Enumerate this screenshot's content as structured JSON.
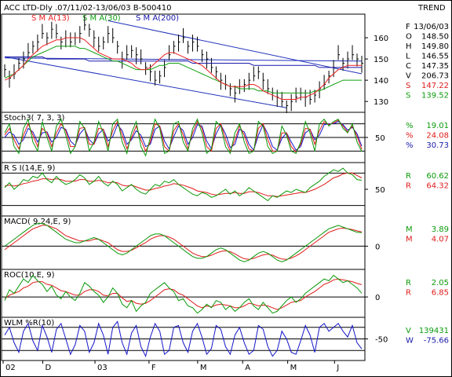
{
  "header": {
    "title": "ACC LTD-Dly .07/11/02-13/06/03   B-500410",
    "right": "TREND"
  },
  "colors": {
    "price": "#000000",
    "sma13": "#ee2222",
    "sma30": "#11a011",
    "sma200": "#1a1aaa",
    "channel": "#2233bb",
    "blueLine": "#1515c8",
    "red": "#e01b1b",
    "green": "#0a9a0a"
  },
  "chart_data": [
    {
      "id": "price",
      "type": "line",
      "legend": [
        {
          "name": "S M A(13)",
          "color": "#ee2222"
        },
        {
          "name": "S M A(30)",
          "color": "#11a011"
        },
        {
          "name": "S M A(200)",
          "color": "#1a1aaa"
        }
      ],
      "yticks": [
        130,
        140,
        150,
        160
      ],
      "ylim": [
        126,
        170
      ],
      "info": [
        {
          "label": "F",
          "value": "13/06/03"
        },
        {
          "label": "O",
          "value": "148.50"
        },
        {
          "label": "H",
          "value": "149.80"
        },
        {
          "label": "L",
          "value": "146.55"
        },
        {
          "label": "C",
          "value": "147.35"
        },
        {
          "label": "V",
          "value": "206.73"
        },
        {
          "label": "S",
          "value": "147.22",
          "color": "#e01b1b"
        },
        {
          "label": "S",
          "value": "139.52",
          "color": "#0a9a0a"
        }
      ],
      "close_series": [
        145,
        141,
        143,
        148,
        150,
        153,
        156,
        158,
        162,
        160,
        164,
        162,
        158,
        160,
        158,
        160,
        162,
        166,
        164,
        160,
        156,
        158,
        162,
        160,
        156,
        150,
        152,
        154,
        152,
        150,
        146,
        144,
        140,
        142,
        146,
        152,
        156,
        158,
        160,
        156,
        158,
        156,
        152,
        150,
        146,
        144,
        140,
        138,
        136,
        134,
        136,
        138,
        140,
        142,
        144,
        140,
        136,
        134,
        132,
        130,
        128,
        130,
        132,
        134,
        132,
        131,
        133,
        136,
        138,
        142,
        146,
        152,
        148,
        150,
        152,
        150,
        148
      ],
      "sma13": [
        140,
        141,
        143,
        145,
        147,
        150,
        152,
        154,
        156,
        157,
        158,
        159,
        159,
        160,
        160,
        160,
        160,
        159,
        157,
        155,
        153,
        152,
        151,
        150,
        150,
        150,
        149,
        148,
        146,
        145,
        145,
        146,
        148,
        150,
        152,
        153,
        153,
        152,
        151,
        150,
        149,
        148,
        147,
        145,
        143,
        141,
        139,
        138,
        137,
        137,
        137,
        137,
        138,
        138,
        137,
        135,
        134,
        133,
        132,
        131,
        131,
        131,
        131,
        132,
        132,
        133,
        134,
        136,
        138,
        141,
        143,
        145,
        146,
        147,
        147,
        147,
        147
      ],
      "sma30": [
        141,
        142,
        143,
        145,
        147,
        149,
        151,
        152,
        153,
        154,
        155,
        156,
        156,
        156,
        156,
        156,
        155,
        155,
        154,
        153,
        152,
        151,
        150,
        149,
        149,
        148,
        147,
        146,
        145,
        145,
        145,
        145,
        146,
        147,
        147,
        148,
        148,
        148,
        147,
        146,
        145,
        144,
        143,
        142,
        141,
        140,
        139,
        138,
        137,
        137,
        136,
        136,
        136,
        136,
        135,
        135,
        135,
        134,
        134,
        134,
        134,
        134,
        134,
        134,
        134,
        134,
        135,
        135,
        136,
        137,
        138,
        139,
        140,
        140,
        140,
        140,
        140
      ],
      "sma200": [
        151,
        151,
        151,
        151,
        151,
        151,
        151,
        151,
        151,
        150,
        150,
        150,
        150,
        150,
        150,
        150,
        150,
        150,
        149,
        149,
        149,
        149,
        149,
        149,
        149,
        149,
        149,
        149,
        149,
        149,
        149,
        149,
        149,
        149,
        149,
        149,
        149,
        149,
        149,
        149,
        148,
        148,
        148,
        148,
        148,
        148,
        148,
        148,
        148,
        148,
        148,
        148,
        148,
        147,
        147,
        147,
        147,
        147,
        147,
        147,
        147,
        147,
        147,
        147,
        147,
        147,
        147,
        146,
        146,
        146,
        146,
        146,
        146,
        146,
        146,
        146,
        146
      ]
    },
    {
      "id": "stoch",
      "type": "line",
      "title": "Stoch3( 7, 3, 3)",
      "ytick": "50",
      "levels": [
        20,
        50,
        80
      ],
      "ylim": [
        0,
        100
      ],
      "info": [
        {
          "label": "%",
          "value": "19.01",
          "color": "#0a9a0a"
        },
        {
          "label": "%",
          "value": "24.08",
          "color": "#e01b1b"
        },
        {
          "label": "%",
          "value": "30.73",
          "color": "#1a1aaa"
        }
      ],
      "series_k": [
        60,
        80,
        30,
        15,
        70,
        90,
        40,
        20,
        85,
        50,
        20,
        75,
        90,
        55,
        15,
        30,
        85,
        70,
        20,
        40,
        85,
        60,
        20,
        80,
        90,
        40,
        15,
        60,
        85,
        30,
        10,
        50,
        90,
        70,
        15,
        20,
        80,
        85,
        40,
        20,
        70,
        90,
        60,
        15,
        25,
        85,
        75,
        30,
        15,
        60,
        80,
        40,
        15,
        20,
        85,
        75,
        30,
        15,
        20,
        75,
        55,
        20,
        15,
        40,
        85,
        60,
        20,
        80,
        90,
        75,
        85,
        90,
        70,
        60,
        80,
        40,
        19
      ],
      "series_d": [
        55,
        70,
        45,
        25,
        55,
        80,
        55,
        30,
        70,
        60,
        30,
        60,
        80,
        65,
        30,
        30,
        70,
        72,
        35,
        35,
        70,
        68,
        30,
        65,
        85,
        55,
        25,
        50,
        75,
        45,
        20,
        40,
        80,
        75,
        30,
        20,
        65,
        80,
        55,
        25,
        60,
        85,
        70,
        30,
        20,
        70,
        80,
        45,
        20,
        45,
        75,
        55,
        25,
        20,
        70,
        80,
        45,
        20,
        20,
        60,
        60,
        30,
        18,
        35,
        70,
        68,
        35,
        65,
        85,
        78,
        82,
        88,
        75,
        62,
        75,
        52,
        24
      ],
      "series_s": [
        50,
        62,
        55,
        35,
        45,
        70,
        62,
        40,
        60,
        62,
        40,
        50,
        72,
        68,
        42,
        32,
        58,
        70,
        45,
        35,
        58,
        68,
        42,
        52,
        78,
        65,
        35,
        45,
        65,
        55,
        30,
        35,
        68,
        75,
        42,
        25,
        52,
        75,
        65,
        35,
        50,
        78,
        75,
        42,
        25,
        58,
        78,
        58,
        28,
        35,
        68,
        62,
        35,
        22,
        55,
        78,
        58,
        30,
        22,
        48,
        60,
        40,
        22,
        30,
        60,
        68,
        45,
        55,
        78,
        80,
        80,
        85,
        78,
        66,
        72,
        58,
        31
      ]
    },
    {
      "id": "rsi",
      "type": "line",
      "title": "R S I(14,E, 9)",
      "ytick": "50",
      "levels": [
        30,
        70
      ],
      "ylim": [
        20,
        80
      ],
      "info": [
        {
          "label": "R",
          "value": "60.62",
          "color": "#0a9a0a"
        },
        {
          "label": "R",
          "value": "64.32",
          "color": "#e01b1b"
        }
      ],
      "series_rsi": [
        52,
        58,
        50,
        55,
        62,
        60,
        66,
        64,
        70,
        62,
        58,
        66,
        60,
        56,
        58,
        62,
        68,
        64,
        56,
        60,
        66,
        58,
        54,
        60,
        56,
        48,
        52,
        56,
        50,
        46,
        44,
        50,
        56,
        54,
        60,
        58,
        62,
        56,
        52,
        48,
        44,
        42,
        46,
        44,
        40,
        42,
        46,
        50,
        44,
        48,
        42,
        46,
        52,
        48,
        44,
        40,
        36,
        42,
        40,
        44,
        48,
        46,
        50,
        48,
        46,
        52,
        56,
        60,
        66,
        70,
        74,
        72,
        76,
        70,
        68,
        62,
        61
      ],
      "series_sig": [
        54,
        55,
        54,
        55,
        57,
        58,
        60,
        61,
        63,
        63,
        62,
        63,
        62,
        60,
        60,
        60,
        62,
        62,
        60,
        60,
        61,
        60,
        58,
        59,
        58,
        55,
        54,
        55,
        53,
        51,
        49,
        49,
        51,
        52,
        54,
        55,
        57,
        56,
        55,
        53,
        51,
        48,
        47,
        46,
        44,
        43,
        44,
        45,
        45,
        46,
        45,
        45,
        47,
        47,
        46,
        44,
        42,
        42,
        41,
        42,
        43,
        44,
        45,
        46,
        46,
        48,
        50,
        53,
        56,
        60,
        64,
        66,
        69,
        70,
        70,
        67,
        64
      ]
    },
    {
      "id": "macd",
      "type": "line",
      "title": "MACD( 9,24,E, 9)",
      "ytick": "0",
      "levels": [
        0
      ],
      "ylim": [
        -6,
        8
      ],
      "info": [
        {
          "label": "M",
          "value": "3.89",
          "color": "#0a9a0a"
        },
        {
          "label": "M",
          "value": "4.07",
          "color": "#e01b1b"
        }
      ],
      "series_macd": [
        0,
        1,
        2,
        3,
        4,
        5,
        6,
        6.5,
        6.5,
        6,
        5,
        4,
        3,
        2,
        1.5,
        1,
        1,
        1.5,
        2,
        2.5,
        2,
        1,
        0,
        -1,
        -2,
        -2.5,
        -2,
        -1,
        0,
        1,
        2,
        3,
        3.5,
        3.5,
        3,
        2,
        1,
        0,
        -1,
        -2,
        -3,
        -3.5,
        -3.5,
        -3,
        -2,
        -1,
        -0.5,
        -1,
        -2,
        -3,
        -4,
        -4.5,
        -4,
        -3,
        -2,
        -1.5,
        -2,
        -3,
        -4,
        -4.5,
        -4,
        -3,
        -2,
        -1,
        0,
        1,
        2,
        3,
        4,
        5,
        5.5,
        6,
        5.5,
        5,
        4.5,
        4,
        3.89
      ],
      "series_sig": [
        -1,
        0,
        1,
        2,
        3,
        4,
        5,
        5.5,
        6,
        6,
        5.5,
        5,
        4,
        3,
        2.5,
        2,
        1.5,
        1.5,
        1.5,
        2,
        2,
        1.5,
        1,
        0,
        -1,
        -1.5,
        -1.5,
        -1.2,
        -0.5,
        0.3,
        1,
        2,
        2.6,
        3,
        3,
        2.6,
        2,
        1,
        0,
        -1,
        -2,
        -2.6,
        -3,
        -3,
        -2.6,
        -2,
        -1.5,
        -1.3,
        -1.6,
        -2.2,
        -3,
        -3.6,
        -3.8,
        -3.5,
        -3,
        -2.5,
        -2.3,
        -2.6,
        -3.2,
        -3.7,
        -3.8,
        -3.4,
        -2.8,
        -2,
        -1,
        0,
        1,
        2,
        3,
        4,
        4.5,
        5,
        5.2,
        5,
        4.8,
        4.4,
        4.07
      ]
    },
    {
      "id": "roc",
      "type": "line",
      "title": "ROC(10,E, 9)",
      "ytick": "0",
      "levels": [
        0
      ],
      "ylim": [
        -10,
        14
      ],
      "info": [
        {
          "label": "R",
          "value": "2.05",
          "color": "#0a9a0a"
        },
        {
          "label": "R",
          "value": "6.85",
          "color": "#e01b1b"
        }
      ],
      "series_roc": [
        -2,
        4,
        2,
        6,
        10,
        8,
        12,
        9,
        7,
        3,
        6,
        1,
        -1,
        3,
        0,
        -2,
        2,
        8,
        6,
        3,
        1,
        -3,
        0,
        5,
        2,
        -4,
        -6,
        -2,
        -8,
        -5,
        -3,
        2,
        4,
        6,
        8,
        5,
        3,
        -2,
        -1,
        -5,
        -6,
        -9,
        -7,
        -4,
        -6,
        -2,
        -3,
        -7,
        -5,
        -8,
        -6,
        -3,
        -1,
        -5,
        -7,
        -3,
        -6,
        -9,
        -8,
        -5,
        -2,
        0,
        -3,
        -1,
        2,
        4,
        6,
        8,
        10,
        9,
        12,
        10,
        8,
        9,
        7,
        5,
        2.05
      ],
      "series_sig": [
        -1,
        1,
        2,
        3,
        5,
        6,
        8,
        8.5,
        8.5,
        7,
        6.5,
        5,
        3.5,
        3,
        2,
        1,
        1,
        3,
        4,
        4,
        3,
        1,
        0.5,
        2,
        2,
        -0.5,
        -2.5,
        -2,
        -3.5,
        -4,
        -3.5,
        -2,
        0,
        2,
        4,
        4.5,
        4,
        2,
        1,
        -1,
        -3,
        -5,
        -6,
        -5,
        -5.5,
        -4.5,
        -4,
        -4.5,
        -5,
        -6,
        -6,
        -5,
        -3.5,
        -4,
        -5,
        -4.5,
        -5,
        -6,
        -7,
        -6,
        -4.5,
        -3,
        -2.5,
        -2,
        0,
        1.5,
        3,
        5,
        7,
        8,
        9.5,
        10,
        9.5,
        9,
        8.5,
        7.5,
        6.85
      ]
    },
    {
      "id": "wlm",
      "type": "line",
      "title": "WLM %R(10)",
      "ytick": "-50",
      "levels": [
        -20,
        -50,
        -80
      ],
      "ylim": [
        -100,
        0
      ],
      "info": [
        {
          "label": "V",
          "value": "139431",
          "color": "#0a9a0a"
        },
        {
          "label": "W",
          "value": "-75.66",
          "color": "#1a1aaa"
        }
      ],
      "series_w": [
        -40,
        -20,
        -60,
        -85,
        -30,
        -10,
        -55,
        -80,
        -15,
        -45,
        -85,
        -25,
        -10,
        -50,
        -90,
        -65,
        -15,
        -30,
        -85,
        -60,
        -10,
        -40,
        -90,
        -20,
        -5,
        -60,
        -90,
        -35,
        -15,
        -70,
        -95,
        -45,
        -10,
        -30,
        -90,
        -80,
        -20,
        -15,
        -60,
        -85,
        -30,
        -10,
        -45,
        -90,
        -75,
        -15,
        -25,
        -70,
        -90,
        -40,
        -20,
        -60,
        -90,
        -80,
        -15,
        -25,
        -70,
        -95,
        -80,
        -30,
        -50,
        -85,
        -90,
        -55,
        -15,
        -40,
        -85,
        -20,
        -10,
        -30,
        -20,
        -10,
        -30,
        -45,
        -15,
        -60,
        -76
      ]
    }
  ],
  "xaxis": {
    "labels": [
      "02",
      "D",
      "03",
      "F",
      "M",
      "A",
      "M",
      "J"
    ]
  }
}
